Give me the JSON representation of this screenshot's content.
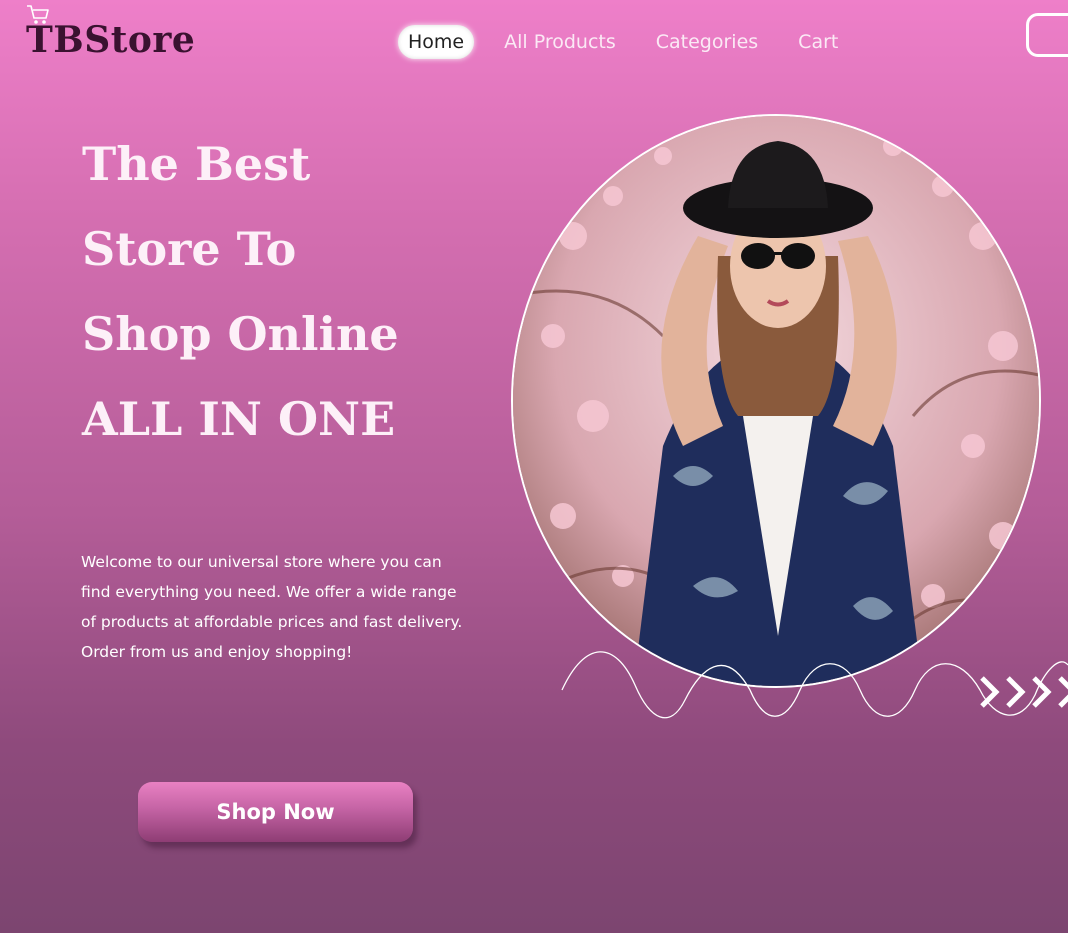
{
  "brand": {
    "name": "TBStore",
    "logo_icon": "shopping-cart-icon"
  },
  "nav": {
    "items": [
      {
        "label": "Home",
        "active": true
      },
      {
        "label": "All Products",
        "active": false
      },
      {
        "label": "Categories",
        "active": false
      },
      {
        "label": "Cart",
        "active": false
      }
    ]
  },
  "hero": {
    "headline": [
      "The Best",
      "Store To",
      "Shop Online",
      "ALL IN ONE"
    ],
    "description": "Welcome to our universal store where you can find everything you need. We offer a wide range of products at affordable prices and fast delivery. Order from us and enjoy shopping!",
    "cta_label": "Shop Now"
  },
  "colors": {
    "background_top": "#ee7fc9",
    "background_bottom": "#7c4570",
    "brand_text": "#3a1230",
    "accent": "#c463a4"
  }
}
